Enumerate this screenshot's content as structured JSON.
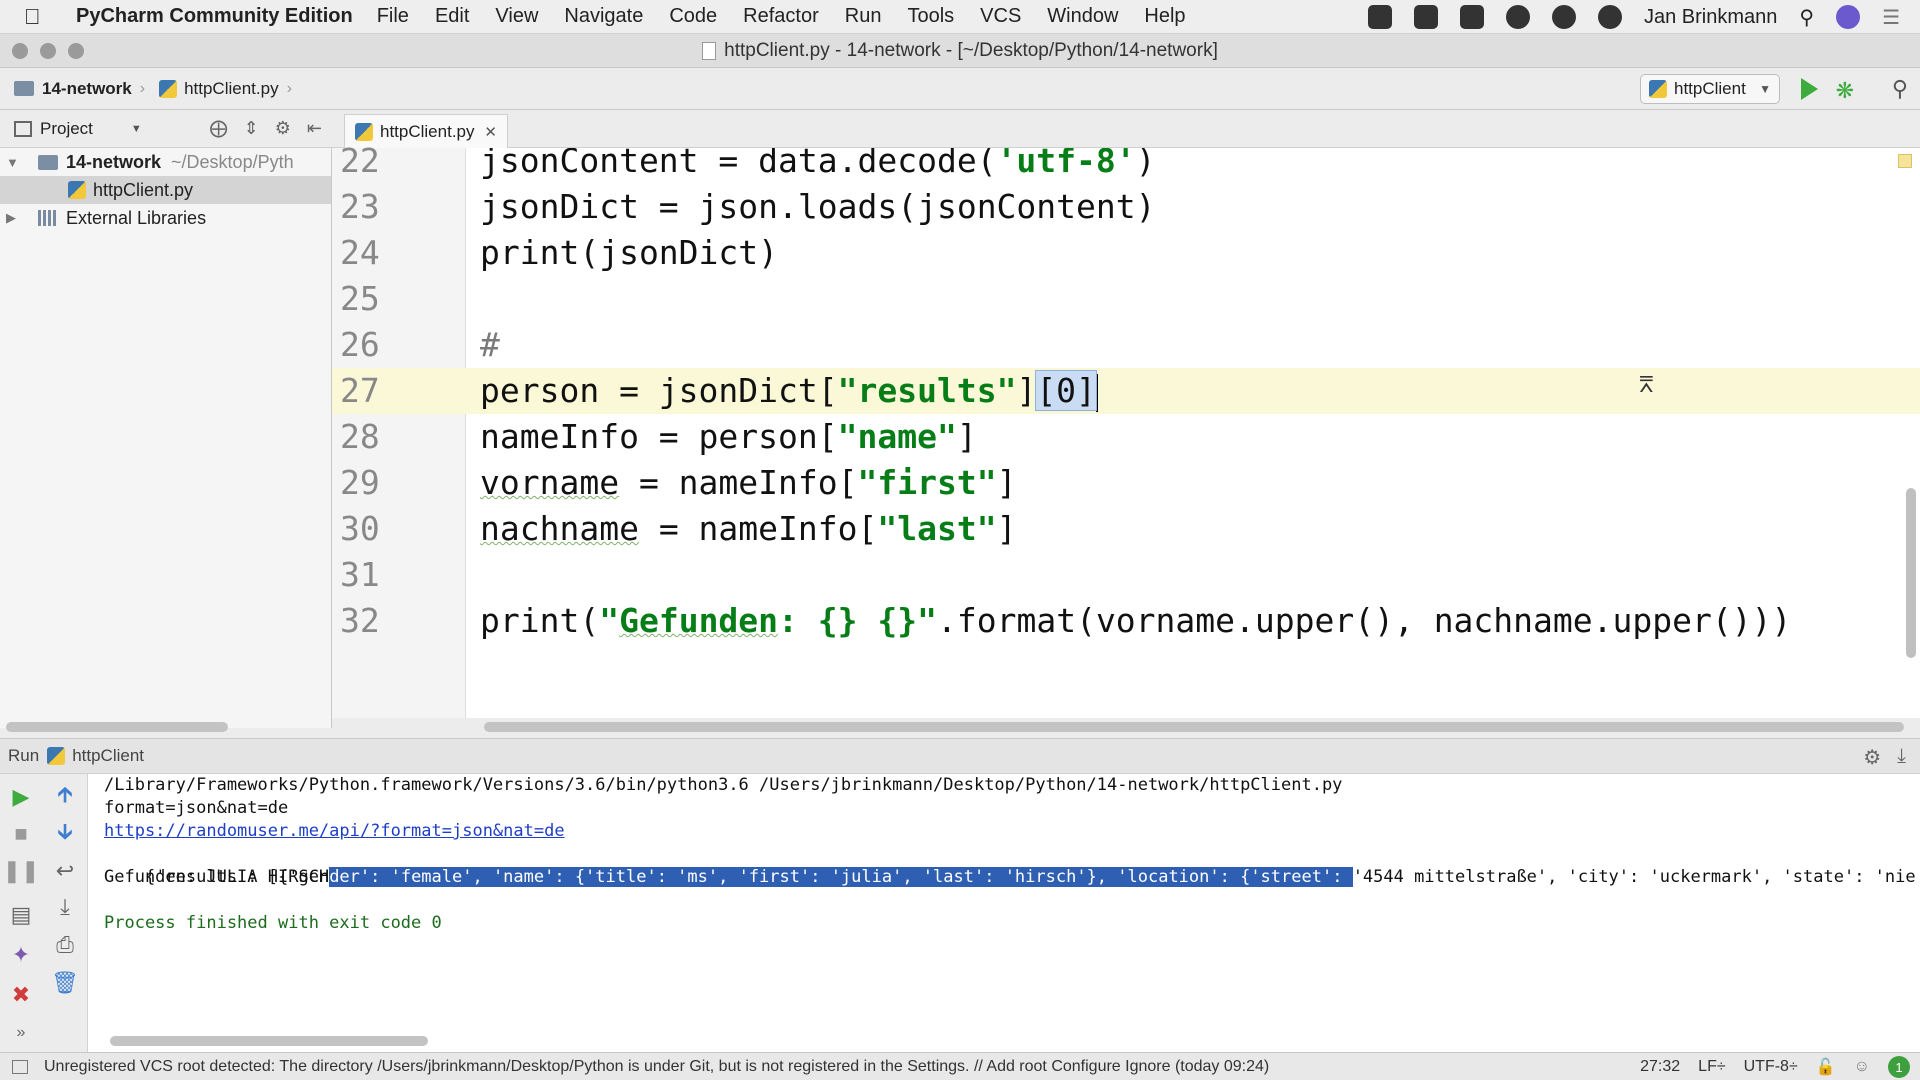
{
  "menubar": {
    "app_name": "PyCharm Community Edition",
    "items": [
      "File",
      "Edit",
      "View",
      "Navigate",
      "Code",
      "Refactor",
      "Run",
      "Tools",
      "VCS",
      "Window",
      "Help"
    ],
    "user": "Jan Brinkmann"
  },
  "window": {
    "title": "httpClient.py - 14-network - [~/Desktop/Python/14-network]"
  },
  "navbar": {
    "project_crumb": "14-network",
    "file_crumb": "httpClient.py",
    "run_config": "httpClient"
  },
  "project_panel": {
    "header": "Project",
    "root_name": "14-network",
    "root_path": "~/Desktop/Pyth",
    "file": "httpClient.py",
    "libraries": "External Libraries"
  },
  "editor": {
    "tab_label": "httpClient.py",
    "line_numbers": [
      "22",
      "23",
      "24",
      "25",
      "26",
      "27",
      "28",
      "29",
      "30",
      "31",
      "32"
    ]
  },
  "run_panel": {
    "label": "Run",
    "config": "httpClient",
    "console": {
      "cmd": "/Library/Frameworks/Python.framework/Versions/3.6/bin/python3.6 /Users/jbrinkmann/Desktop/Python/14-network/httpClient.py",
      "params": "format=json&nat=de",
      "url": "https://randomuser.me/api/?format=json&nat=de",
      "result_prefix": "{'results': [{'gen",
      "result_selected": "der': 'female', 'name': {'title': 'ms', 'first': 'julia', 'last': 'hirsch'}, 'location': {'street': ",
      "result_suffix": "'4544 mittelstraße', 'city': 'uckermark', 'state': 'nie",
      "found": "Gefunden: JULIA HIRSCH",
      "exit": "Process finished with exit code 0"
    }
  },
  "statusbar": {
    "message": "Unregistered VCS root detected: The directory /Users/jbrinkmann/Desktop/Python is under Git, but is not registered in the Settings. // Add root  Configure  Ignore (today 09:24)",
    "position": "27:32",
    "line_sep": "LF÷",
    "encoding": "UTF-8÷",
    "badge": "1"
  },
  "icons": [
    "apple-icon",
    "folder-icon",
    "python-file-icon",
    "run-icon",
    "debug-icon",
    "search-icon",
    "close-icon",
    "gear-icon",
    "library-icon"
  ],
  "colors": {
    "run_green": "#3eab3e",
    "string_green": "#067d17",
    "selection_blue": "#2f5fb3",
    "current_line": "#fbf8d8",
    "link_blue": "#1e3ec7"
  }
}
